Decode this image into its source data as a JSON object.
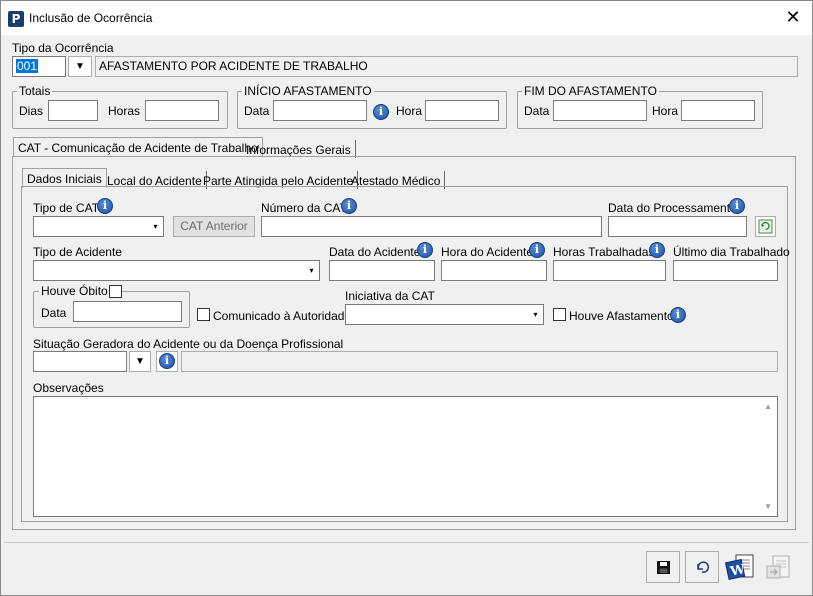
{
  "window": {
    "title": "Inclusão de Ocorrência",
    "app_icon_letter": "P",
    "close_symbol": "✕"
  },
  "tipo_ocorrencia": {
    "label": "Tipo da Ocorrência",
    "code": "001",
    "description": "AFASTAMENTO POR ACIDENTE DE TRABALHO"
  },
  "totais": {
    "title": "Totais",
    "dias_label": "Dias",
    "dias_value": "",
    "horas_label": "Horas",
    "horas_value": ""
  },
  "inicio_afastamento": {
    "title": "INÍCIO AFASTAMENTO",
    "data_label": "Data",
    "data_value": "",
    "hora_label": "Hora",
    "hora_value": ""
  },
  "fim_afastamento": {
    "title": "FIM DO AFASTAMENTO",
    "data_label": "Data",
    "data_value": "",
    "hora_label": "Hora",
    "hora_value": ""
  },
  "outer_tabs": [
    {
      "label": "CAT - Comunicação de Acidente de Trabalho",
      "active": true
    },
    {
      "label": "Informações Gerais",
      "active": false
    }
  ],
  "inner_tabs": [
    {
      "label": "Dados Iniciais",
      "active": true
    },
    {
      "label": "Local do Acidente",
      "active": false
    },
    {
      "label": "Parte Atingida pelo Acidente",
      "active": false
    },
    {
      "label": "Atestado Médico",
      "active": false
    }
  ],
  "dados_iniciais": {
    "tipo_cat_label": "Tipo de CAT",
    "tipo_cat_value": "",
    "cat_anterior_button": "CAT Anterior",
    "numero_cat_label": "Número da CAT",
    "numero_cat_value": "",
    "data_processamento_label": "Data do Processamento",
    "data_processamento_value": "",
    "tipo_acidente_label": "Tipo de Acidente",
    "tipo_acidente_value": "",
    "data_acidente_label": "Data do Acidente",
    "data_acidente_value": "",
    "hora_acidente_label": "Hora do Acidente",
    "hora_acidente_value": "",
    "horas_trabalhadas_label": "Horas Trabalhadas",
    "horas_trabalhadas_value": "",
    "ultimo_dia_label": "Último dia Trabalhado",
    "ultimo_dia_value": "",
    "houve_obito_label": "Houve Óbito",
    "obito_data_label": "Data",
    "obito_data_value": "",
    "comunicado_autoridade_label": "Comunicado à Autoridade",
    "iniciativa_cat_label": "Iniciativa da CAT",
    "iniciativa_cat_value": "",
    "houve_afastamento_label": "Houve Afastamento",
    "situacao_geradora_label": "Situação Geradora do Acidente ou da Doença Profissional",
    "situacao_geradora_code": "",
    "situacao_geradora_desc": "",
    "observacoes_label": "Observações",
    "observacoes_value": ""
  },
  "icons": {
    "info": "i",
    "dropdown": "▼",
    "combo_arrow": "▾",
    "scroll_up": "▲",
    "scroll_down": "▼"
  },
  "colors": {
    "window_bg": "#f0f0f0",
    "title_bg": "#ffffff",
    "info_icon": "#1a4ea8",
    "selection": "#0078d7"
  }
}
